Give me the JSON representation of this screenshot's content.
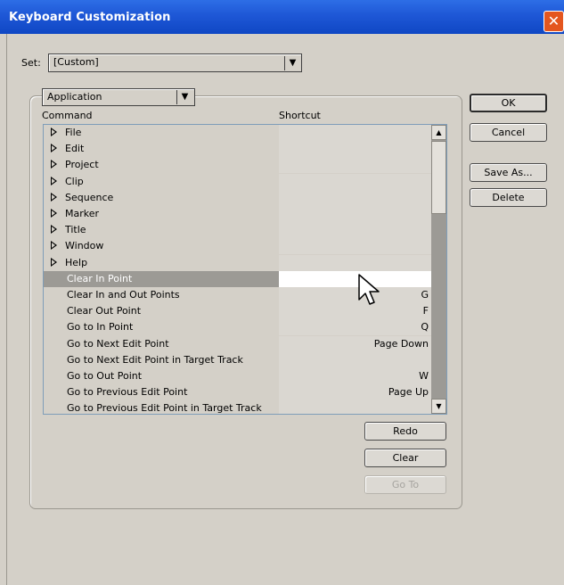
{
  "window": {
    "title": "Keyboard Customization"
  },
  "set": {
    "label": "Set:",
    "value": "[Custom]"
  },
  "category": {
    "value": "Application"
  },
  "columns": {
    "command": "Command",
    "shortcut": "Shortcut"
  },
  "rows": [
    {
      "command": "File",
      "shortcut": "",
      "expandable": true
    },
    {
      "command": "Edit",
      "shortcut": "",
      "expandable": true
    },
    {
      "command": "Project",
      "shortcut": "",
      "expandable": true
    },
    {
      "command": "Clip",
      "shortcut": "",
      "expandable": true
    },
    {
      "command": "Sequence",
      "shortcut": "",
      "expandable": true
    },
    {
      "command": "Marker",
      "shortcut": "",
      "expandable": true
    },
    {
      "command": "Title",
      "shortcut": "",
      "expandable": true
    },
    {
      "command": "Window",
      "shortcut": "",
      "expandable": true
    },
    {
      "command": "Help",
      "shortcut": "",
      "expandable": true
    },
    {
      "command": "Clear In Point",
      "shortcut": "",
      "expandable": false,
      "selected": true
    },
    {
      "command": "Clear In and Out Points",
      "shortcut": "G",
      "expandable": false
    },
    {
      "command": "Clear Out Point",
      "shortcut": "F",
      "expandable": false
    },
    {
      "command": "Go to In Point",
      "shortcut": "Q",
      "expandable": false
    },
    {
      "command": "Go to Next Edit Point",
      "shortcut": "Page Down",
      "expandable": false
    },
    {
      "command": "Go to Next Edit Point in Target Track",
      "shortcut": "",
      "expandable": false
    },
    {
      "command": "Go to Out Point",
      "shortcut": "W",
      "expandable": false
    },
    {
      "command": "Go to Previous Edit Point",
      "shortcut": "Page Up",
      "expandable": false
    },
    {
      "command": "Go to Previous Edit Point in Target Track",
      "shortcut": "",
      "expandable": false
    }
  ],
  "buttons": {
    "ok": "OK",
    "cancel": "Cancel",
    "save_as": "Save As...",
    "delete": "Delete",
    "redo": "Redo",
    "clear": "Clear",
    "go_to": "Go To"
  },
  "icons": {
    "close": "close-icon",
    "dropdown": "dropdown-arrow-icon",
    "expand": "expand-triangle-icon",
    "cursor": "mouse-pointer-icon"
  },
  "colors": {
    "title_bar": "#1e57d6",
    "close_button": "#e4561f",
    "dialog_bg": "#d4d0c8",
    "selected_row": "#9c9a95"
  }
}
